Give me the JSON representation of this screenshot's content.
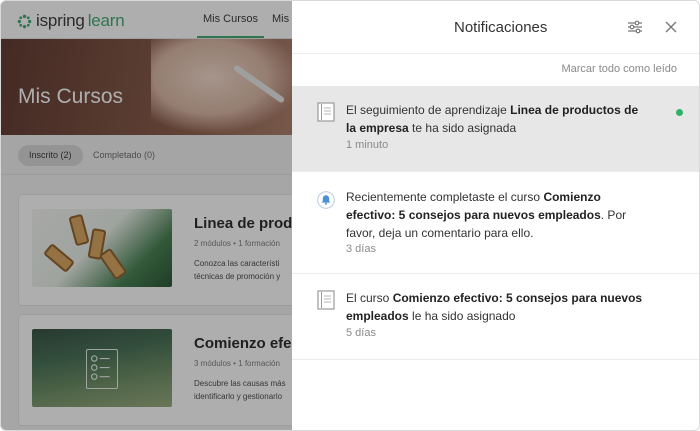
{
  "app": {
    "brand_prefix": "ispring",
    "brand_suffix": "learn"
  },
  "nav": {
    "items": [
      {
        "label": "Mis Cursos"
      },
      {
        "label": "Mis C"
      }
    ]
  },
  "hero": {
    "title": "Mis Cursos"
  },
  "filters": {
    "enrolled": "Inscrito (2)",
    "completed": "Completado (0)"
  },
  "courses": [
    {
      "title": "Linea de produc",
      "meta": "2 módulos • 1 formación",
      "description_line1": "Conozca las característi",
      "description_line2": "técnicas de promoción y"
    },
    {
      "title": "Comienzo efect",
      "meta": "3 módulos • 1 formación",
      "description_line1": "Descubre las causas más",
      "description_line2": "identificarlo y gestionarlo"
    }
  ],
  "panel": {
    "title": "Notificaciones",
    "mark_all_read": "Marcar todo como leído",
    "notifications": [
      {
        "icon": "document-icon",
        "part1": "El seguimiento de aprendizaje ",
        "bold1": "Linea de productos de la empresa",
        "part2": " te ha sido asignada",
        "time": "1 minuto",
        "unread": true
      },
      {
        "icon": "bell-icon",
        "part1": "Recientemente completaste el curso ",
        "bold1": "Comienzo efectivo: 5 consejos para nuevos empleados",
        "part2": ". Por favor, deja un comentario para ello.",
        "time": "3 días",
        "unread": false
      },
      {
        "icon": "document-icon",
        "part1": "El curso ",
        "bold1": "Comienzo efectivo: 5 consejos para nuevos empleados",
        "part2": " le ha sido asignado",
        "time": "5 días",
        "unread": false
      }
    ]
  },
  "colors": {
    "accent": "#3aa76d",
    "unread_dot": "#2fb36a",
    "unread_background": "#e7e7e7",
    "bell_blue": "#4a90d9"
  }
}
